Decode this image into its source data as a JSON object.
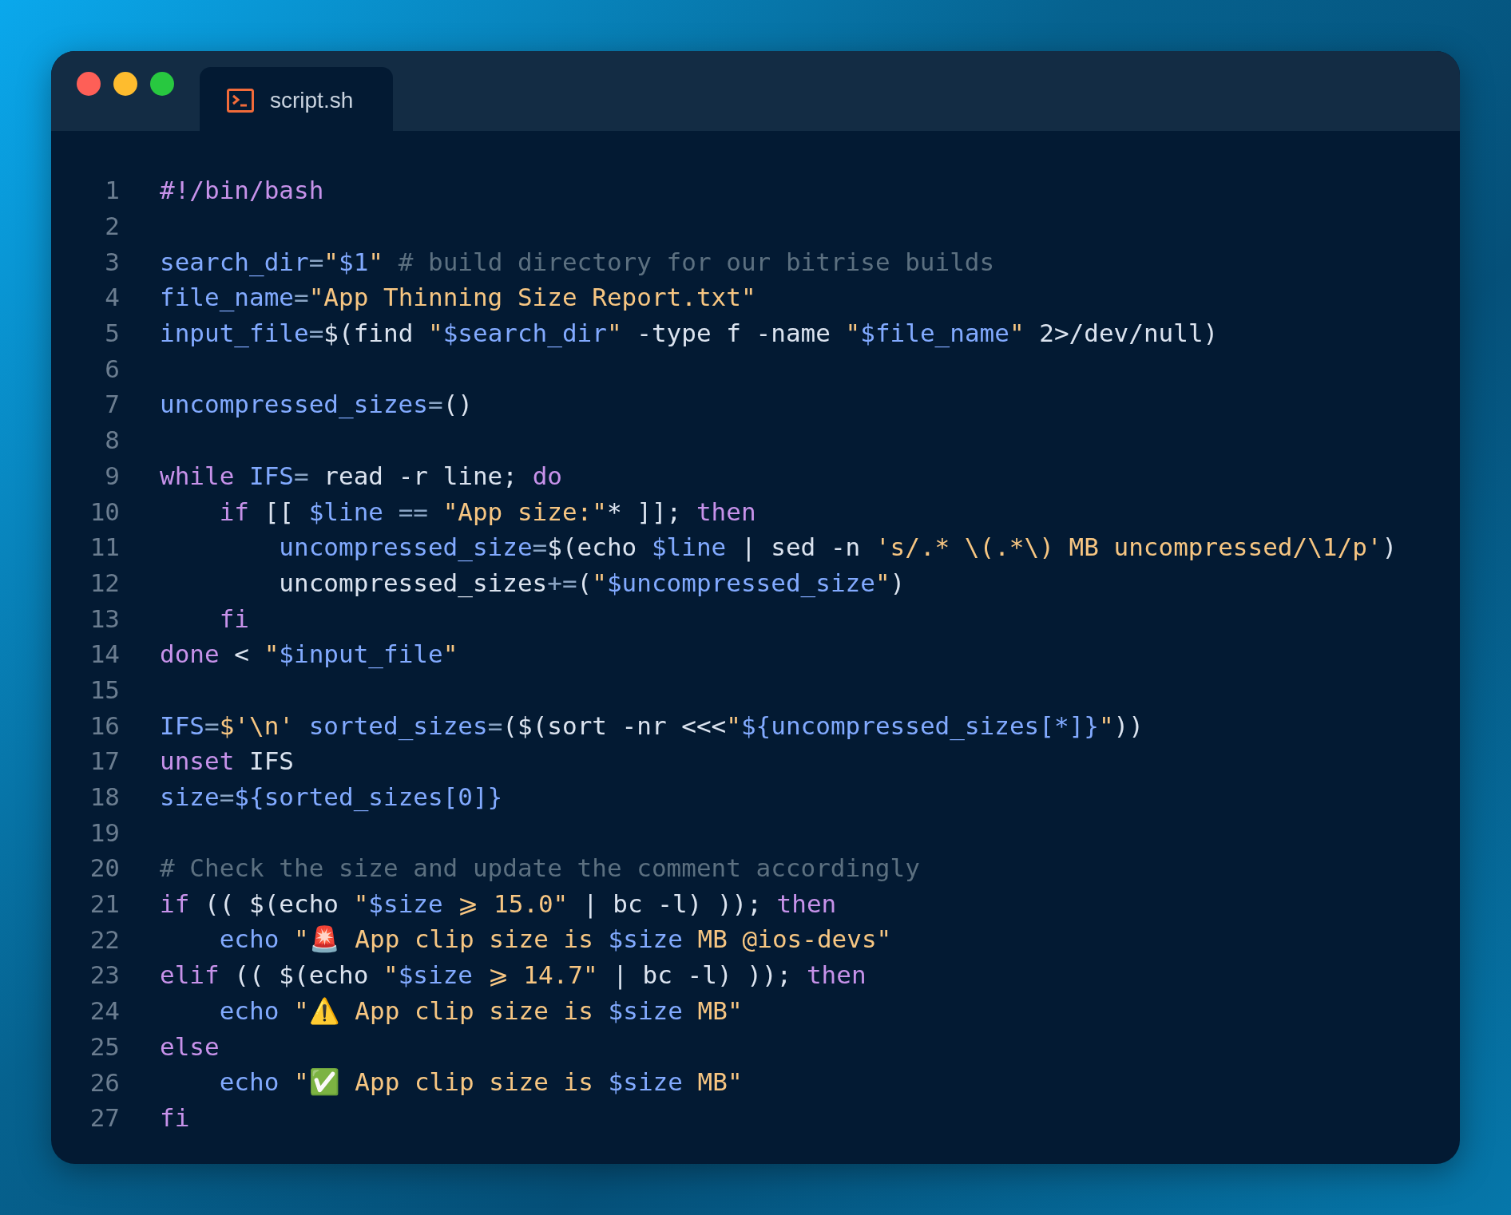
{
  "window": {
    "controls": [
      {
        "kind": "close"
      },
      {
        "kind": "minimize"
      },
      {
        "kind": "zoom"
      }
    ],
    "tabs": [
      {
        "label": "script.sh",
        "selected": true
      }
    ]
  },
  "editor": {
    "lines": [
      {
        "number": "1",
        "tokens": [
          {
            "kind": "kw",
            "text": "#!/bin/bash"
          }
        ]
      },
      {
        "number": "2"
      },
      {
        "number": "3",
        "tokens": [
          {
            "kind": "var",
            "text": "search_dir"
          },
          {
            "kind": "op",
            "text": "="
          },
          {
            "kind": "str",
            "text": "\""
          },
          {
            "kind": "var",
            "text": "$1"
          },
          {
            "kind": "str",
            "text": "\""
          },
          {
            "kind": "com",
            "text": " # build directory for our bitrise builds"
          }
        ]
      },
      {
        "number": "4",
        "tokens": [
          {
            "kind": "var",
            "text": "file_name"
          },
          {
            "kind": "op",
            "text": "="
          },
          {
            "kind": "str",
            "text": "\"App Thinning Size Report.txt\""
          }
        ]
      },
      {
        "number": "5",
        "tokens": [
          {
            "kind": "var",
            "text": "input_file"
          },
          {
            "kind": "op",
            "text": "="
          },
          {
            "kind": "txt",
            "text": "$(find "
          },
          {
            "kind": "str",
            "text": "\""
          },
          {
            "kind": "var",
            "text": "$search_dir"
          },
          {
            "kind": "str",
            "text": "\""
          },
          {
            "kind": "txt",
            "text": " -type f -name "
          },
          {
            "kind": "str",
            "text": "\""
          },
          {
            "kind": "var",
            "text": "$file_name"
          },
          {
            "kind": "str",
            "text": "\""
          },
          {
            "kind": "txt",
            "text": " 2>/dev/null)"
          }
        ]
      },
      {
        "number": "6"
      },
      {
        "number": "7",
        "tokens": [
          {
            "kind": "var",
            "text": "uncompressed_sizes"
          },
          {
            "kind": "op",
            "text": "="
          },
          {
            "kind": "txt",
            "text": "()"
          }
        ]
      },
      {
        "number": "8"
      },
      {
        "number": "9",
        "tokens": [
          {
            "kind": "kw",
            "text": "while"
          },
          {
            "kind": "var",
            "text": " IFS"
          },
          {
            "kind": "op",
            "text": "="
          },
          {
            "kind": "txt",
            "text": " read -r line; "
          },
          {
            "kind": "kw",
            "text": "do"
          }
        ]
      },
      {
        "number": "10",
        "tokens": [
          {
            "kind": "kw",
            "text": "    if"
          },
          {
            "kind": "txt",
            "text": " [[ "
          },
          {
            "kind": "var",
            "text": "$line"
          },
          {
            "kind": "op",
            "text": " == "
          },
          {
            "kind": "str",
            "text": "\"App size:\""
          },
          {
            "kind": "txt",
            "text": "* ]]; "
          },
          {
            "kind": "kw",
            "text": "then"
          }
        ]
      },
      {
        "number": "11",
        "tokens": [
          {
            "kind": "var",
            "text": "        uncompressed_size"
          },
          {
            "kind": "op",
            "text": "="
          },
          {
            "kind": "txt",
            "text": "$(echo "
          },
          {
            "kind": "var",
            "text": "$line"
          },
          {
            "kind": "txt",
            "text": " | sed -n "
          },
          {
            "kind": "str",
            "text": "'s/.* \\(.*\\) MB uncompressed/\\1/p'"
          },
          {
            "kind": "txt",
            "text": ")"
          }
        ]
      },
      {
        "number": "12",
        "tokens": [
          {
            "kind": "txt",
            "text": "        uncompressed_sizes"
          },
          {
            "kind": "op",
            "text": "+="
          },
          {
            "kind": "txt",
            "text": "("
          },
          {
            "kind": "str",
            "text": "\""
          },
          {
            "kind": "var",
            "text": "$uncompressed_size"
          },
          {
            "kind": "str",
            "text": "\""
          },
          {
            "kind": "txt",
            "text": ")"
          }
        ]
      },
      {
        "number": "13",
        "tokens": [
          {
            "kind": "kw",
            "text": "    fi"
          }
        ]
      },
      {
        "number": "14",
        "tokens": [
          {
            "kind": "kw",
            "text": "done"
          },
          {
            "kind": "txt",
            "text": " < "
          },
          {
            "kind": "str",
            "text": "\""
          },
          {
            "kind": "var",
            "text": "$input_file"
          },
          {
            "kind": "str",
            "text": "\""
          }
        ]
      },
      {
        "number": "15"
      },
      {
        "number": "16",
        "tokens": [
          {
            "kind": "var",
            "text": "IFS"
          },
          {
            "kind": "op",
            "text": "="
          },
          {
            "kind": "str",
            "text": "$'\\n'"
          },
          {
            "kind": "var",
            "text": " sorted_sizes"
          },
          {
            "kind": "op",
            "text": "="
          },
          {
            "kind": "txt",
            "text": "($(sort -nr <<<"
          },
          {
            "kind": "str",
            "text": "\""
          },
          {
            "kind": "var",
            "text": "${uncompressed_sizes[*]}"
          },
          {
            "kind": "str",
            "text": "\""
          },
          {
            "kind": "txt",
            "text": "))"
          }
        ]
      },
      {
        "number": "17",
        "tokens": [
          {
            "kind": "kw",
            "text": "unset"
          },
          {
            "kind": "txt",
            "text": " IFS"
          }
        ]
      },
      {
        "number": "18",
        "tokens": [
          {
            "kind": "var",
            "text": "size"
          },
          {
            "kind": "op",
            "text": "="
          },
          {
            "kind": "var",
            "text": "${sorted_sizes[0]}"
          }
        ]
      },
      {
        "number": "19"
      },
      {
        "number": "20",
        "tokens": [
          {
            "kind": "com",
            "text": "# Check the size and update the comment accordingly"
          }
        ]
      },
      {
        "number": "21",
        "tokens": [
          {
            "kind": "kw",
            "text": "if"
          },
          {
            "kind": "txt",
            "text": " (( $(echo "
          },
          {
            "kind": "str",
            "text": "\""
          },
          {
            "kind": "var",
            "text": "$size"
          },
          {
            "kind": "str",
            "text": " ⩾ 15.0\""
          },
          {
            "kind": "txt",
            "text": " | bc -l) )); "
          },
          {
            "kind": "kw",
            "text": "then"
          }
        ]
      },
      {
        "number": "22",
        "tokens": [
          {
            "kind": "var",
            "text": "    echo"
          },
          {
            "kind": "str",
            "text": " \"🚨 App clip size is "
          },
          {
            "kind": "var",
            "text": "$size"
          },
          {
            "kind": "str",
            "text": " MB @ios-devs\""
          }
        ]
      },
      {
        "number": "23",
        "tokens": [
          {
            "kind": "kw",
            "text": "elif"
          },
          {
            "kind": "txt",
            "text": " (( $(echo "
          },
          {
            "kind": "str",
            "text": "\""
          },
          {
            "kind": "var",
            "text": "$size"
          },
          {
            "kind": "str",
            "text": " ⩾ 14.7\""
          },
          {
            "kind": "txt",
            "text": " | bc -l) )); "
          },
          {
            "kind": "kw",
            "text": "then"
          }
        ]
      },
      {
        "number": "24",
        "tokens": [
          {
            "kind": "var",
            "text": "    echo"
          },
          {
            "kind": "str",
            "text": " \"⚠️ App clip size is "
          },
          {
            "kind": "var",
            "text": "$size"
          },
          {
            "kind": "str",
            "text": " MB\""
          }
        ]
      },
      {
        "number": "25",
        "tokens": [
          {
            "kind": "kw",
            "text": "else"
          }
        ]
      },
      {
        "number": "26",
        "tokens": [
          {
            "kind": "var",
            "text": "    echo"
          },
          {
            "kind": "str",
            "text": " \"✅ App clip size is "
          },
          {
            "kind": "var",
            "text": "$size"
          },
          {
            "kind": "str",
            "text": " MB\""
          }
        ]
      },
      {
        "number": "27",
        "tokens": [
          {
            "kind": "kw",
            "text": "fi"
          }
        ]
      }
    ]
  }
}
